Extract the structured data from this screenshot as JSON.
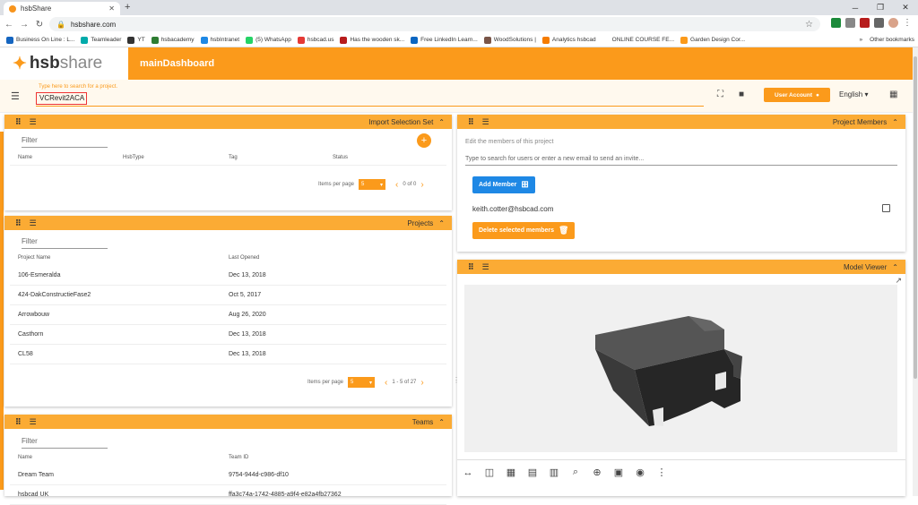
{
  "browser": {
    "tab_title": "hsbShare",
    "url": "hsbshare.com",
    "bookmarks": [
      "Business On Line : L...",
      "Teamleader",
      "YT",
      "hsbacademy",
      "hsbIntranet",
      "(5) WhatsApp",
      "hsbcad.us",
      "Has the wooden sk...",
      "Free LinkedIn Learn...",
      "WoodSolutions |",
      "Analytics hsbcad",
      "ONLINE COURSE FE...",
      "Garden Design Cor..."
    ],
    "bookmarks_more": "»",
    "other_bookmarks": "Other bookmarks"
  },
  "app": {
    "logo_text_1": "hsb",
    "logo_text_2": "share",
    "title": "mainDashboard"
  },
  "toolbar": {
    "search_hint": "Type here to search for a project.",
    "search_value": "VCRevit2ACA",
    "user_account": "User Account",
    "language": "English"
  },
  "import_panel": {
    "title": "Import Selection Set",
    "filter": "Filter",
    "columns": [
      "Name",
      "HsbType",
      "Tag",
      "Status"
    ],
    "items_per_page_label": "Items per page",
    "items_per_page": "5",
    "range": "0 of 0"
  },
  "projects_panel": {
    "title": "Projects",
    "filter": "Filter",
    "columns": [
      "Project Name",
      "Last Opened"
    ],
    "rows": [
      {
        "name": "106-Esmeralda",
        "date": "Dec 13, 2018"
      },
      {
        "name": "424-DakConstructieFase2",
        "date": "Oct 5, 2017"
      },
      {
        "name": "Arrowbouw",
        "date": "Aug 26, 2020"
      },
      {
        "name": "Casthorn",
        "date": "Dec 13, 2018"
      },
      {
        "name": "CL58",
        "date": "Dec 13, 2018"
      }
    ],
    "items_per_page_label": "Items per page",
    "items_per_page": "5",
    "range": "1 - 5 of 27"
  },
  "teams_panel": {
    "title": "Teams",
    "filter": "Filter",
    "columns": [
      "Name",
      "Team ID"
    ],
    "rows": [
      {
        "name": "Dream Team",
        "id": "9754-944d-c986-df10"
      },
      {
        "name": "hsbcad UK",
        "id": "ffa3c74a-1742-4885-a9f4-e82a4fb27362"
      }
    ]
  },
  "members_panel": {
    "title": "Project Members",
    "subtitle": "Edit the members of this project",
    "search_placeholder": "Type to search for users or enter a new email to send an invite...",
    "add_button": "Add Member",
    "member_email": "keith.cotter@hsbcad.com",
    "delete_button": "Delete selected members"
  },
  "viewer_panel": {
    "title": "Model Viewer"
  },
  "colors": {
    "accent": "#fb9a1b",
    "panel_header": "#fbab34",
    "blue_button": "#1e88e5"
  }
}
